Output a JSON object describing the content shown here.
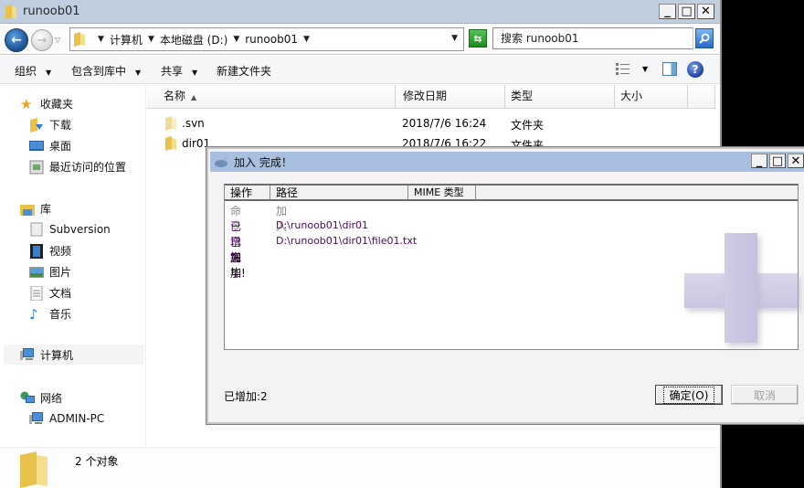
{
  "window": {
    "title": "runoob01",
    "controls": {
      "minimize": "_",
      "maximize": "□",
      "close": "✕"
    }
  },
  "address": {
    "breadcrumbs": [
      "计算机",
      "本地磁盘 (D:)",
      "runoob01"
    ],
    "search_placeholder": "搜索 runoob01"
  },
  "toolbar": {
    "organize": "组织",
    "include_in_library": "包含到库中",
    "share": "共享",
    "new_folder": "新建文件夹"
  },
  "sidebar": {
    "favorites": {
      "label": "收藏夹",
      "items": [
        "下载",
        "桌面",
        "最近访问的位置"
      ]
    },
    "libraries": {
      "label": "库",
      "items": [
        "Subversion",
        "视频",
        "图片",
        "文档",
        "音乐"
      ]
    },
    "computer": {
      "label": "计算机"
    },
    "network": {
      "label": "网络",
      "items": [
        "ADMIN-PC"
      ]
    }
  },
  "file_list": {
    "columns": [
      "名称",
      "修改日期",
      "类型",
      "大小"
    ],
    "rows": [
      {
        "name": ".svn",
        "date": "2018/7/6 16:24",
        "type": "文件夹"
      },
      {
        "name": "dir01",
        "date": "2018/7/6 16:22",
        "type": "文件夹"
      }
    ]
  },
  "statusbar": {
    "count": "2 个对象"
  },
  "dialog": {
    "title": "加入 完成！",
    "columns": [
      "操作",
      "路径",
      "MIME 类型"
    ],
    "rows": [
      {
        "op": "命令",
        "path": "加入",
        "style": "gray"
      },
      {
        "op": "已增加",
        "path": "D:\\runoob01\\dir01",
        "style": "purple"
      },
      {
        "op": "已增加",
        "path": "D:\\runoob01\\dir01\\file01.txt",
        "style": "purple"
      },
      {
        "op": "完毕!",
        "path": "",
        "style": "black"
      }
    ],
    "status": "已增加:2",
    "ok_label": "确定(O)",
    "cancel_label": "取消"
  }
}
